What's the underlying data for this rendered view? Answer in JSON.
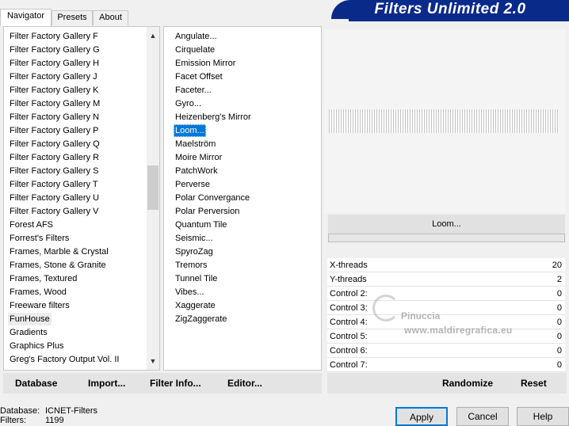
{
  "tabs": [
    {
      "label": "Navigator",
      "active": true
    },
    {
      "label": "Presets",
      "active": false
    },
    {
      "label": "About",
      "active": false
    }
  ],
  "logo": "Filters Unlimited 2.0",
  "categories": [
    "Filter Factory Gallery F",
    "Filter Factory Gallery G",
    "Filter Factory Gallery H",
    "Filter Factory Gallery J",
    "Filter Factory Gallery K",
    "Filter Factory Gallery M",
    "Filter Factory Gallery N",
    "Filter Factory Gallery P",
    "Filter Factory Gallery Q",
    "Filter Factory Gallery R",
    "Filter Factory Gallery S",
    "Filter Factory Gallery T",
    "Filter Factory Gallery U",
    "Filter Factory Gallery V",
    "Forest AFS",
    "Forrest's Filters",
    "Frames, Marble & Crystal",
    "Frames, Stone & Granite",
    "Frames, Textured",
    "Frames, Wood",
    "Freeware filters",
    "FunHouse",
    "Gradients",
    "Graphics Plus",
    "Greg's Factory Output Vol. II"
  ],
  "selected_category": "FunHouse",
  "filters": [
    "Angulate...",
    "Cirquelate",
    "Emission Mirror",
    "Facet Offset",
    "Faceter...",
    "Gyro...",
    "Heizenberg's Mirror",
    "Loom...",
    "Maelström",
    "Moire Mirror",
    "PatchWork",
    "Perverse",
    "Polar Convergance",
    "Polar Perversion",
    "Quantum Tile",
    "Seismic...",
    "SpyroZag",
    "Tremors",
    "Tunnel Tile",
    "Vibes...",
    "Xaggerate",
    "ZigZaggerate"
  ],
  "selected_filter": "Loom...",
  "filter_name_button": "Loom...",
  "controls": [
    {
      "label": "X-threads",
      "value": "20"
    },
    {
      "label": "Y-threads",
      "value": "2"
    },
    {
      "label": "Control 2:",
      "value": "0"
    },
    {
      "label": "Control 3:",
      "value": "0"
    },
    {
      "label": "Control 4:",
      "value": "0"
    },
    {
      "label": "Control 5:",
      "value": "0"
    },
    {
      "label": "Control 6:",
      "value": "0"
    },
    {
      "label": "Control 7:",
      "value": "0"
    }
  ],
  "watermark": {
    "name": "Pinuccia",
    "url": "www.maldiregrafica.eu"
  },
  "left_buttons": {
    "database": "Database",
    "import": "Import...",
    "filter_info": "Filter Info...",
    "editor": "Editor..."
  },
  "right_buttons": {
    "randomize": "Randomize",
    "reset": "Reset"
  },
  "status": {
    "database_label": "Database:",
    "database_value": "ICNET-Filters",
    "filters_label": "Filters:",
    "filters_value": "1199"
  },
  "dialog_buttons": {
    "apply": "Apply",
    "cancel": "Cancel",
    "help": "Help"
  },
  "icons": {
    "scroll_up": "chevron-up-icon",
    "scroll_down": "chevron-down-icon"
  }
}
